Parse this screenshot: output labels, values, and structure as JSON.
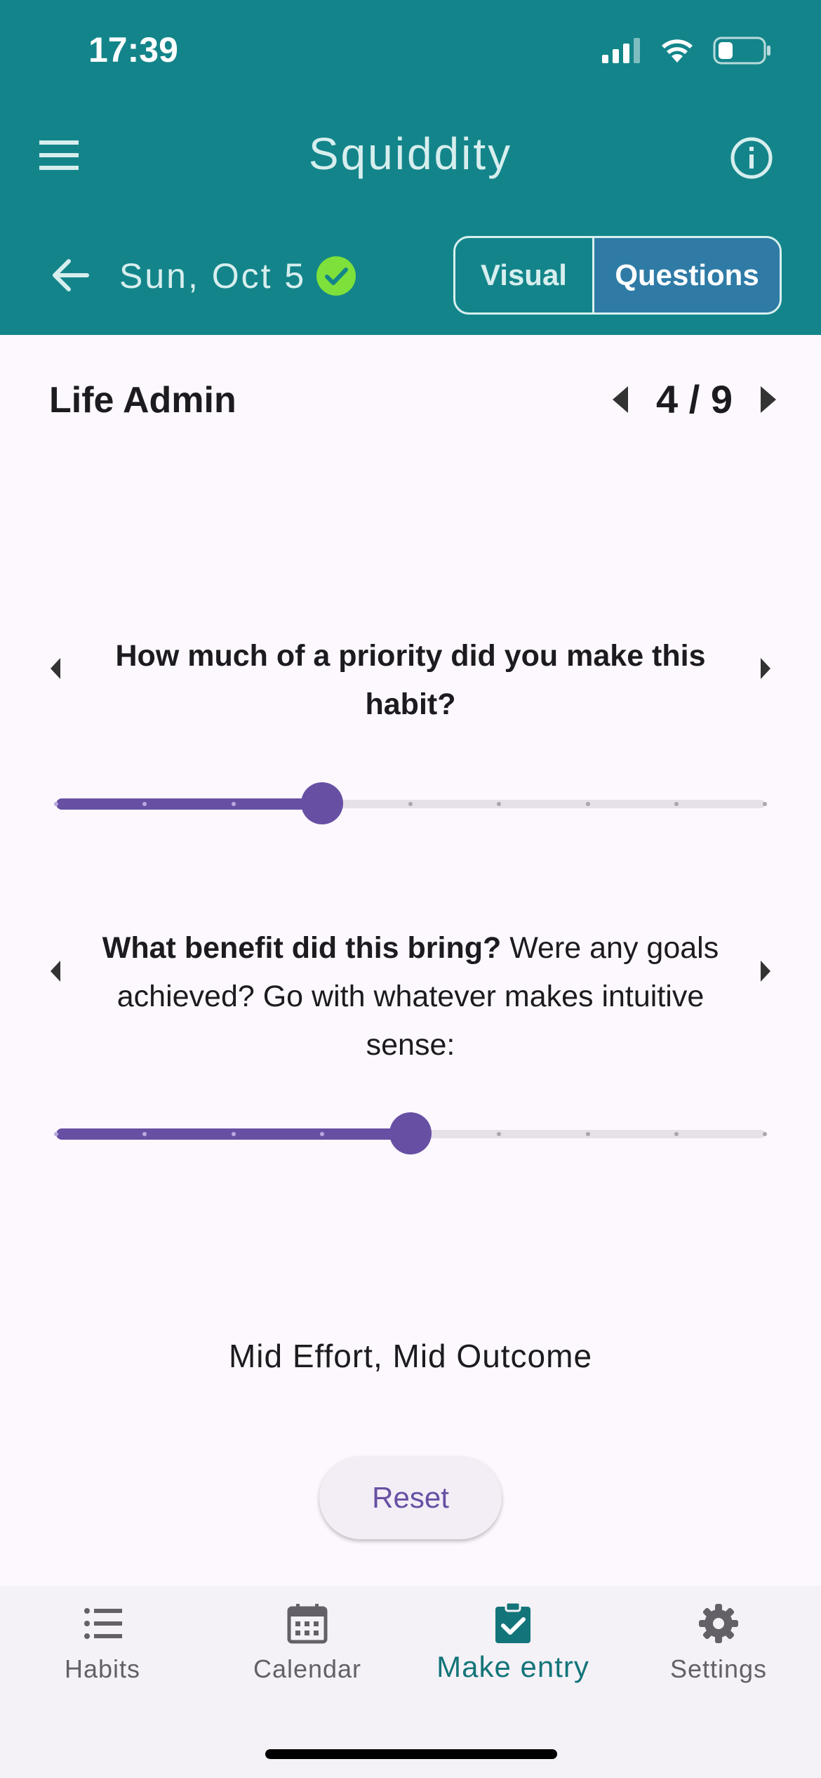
{
  "status_bar": {
    "time": "17:39"
  },
  "header": {
    "title": "Squiddity",
    "date": "Sun, Oct 5",
    "view_toggle": {
      "visual_label": "Visual",
      "questions_label": "Questions",
      "selected": "Questions"
    }
  },
  "section": {
    "title": "Life Admin",
    "page_indicator": "4 / 9"
  },
  "questions": [
    {
      "bold_text": "How much of a priority did you make this habit?",
      "normal_text": "",
      "slider": {
        "value": 3,
        "min": 0,
        "max": 8
      }
    },
    {
      "bold_text": "What benefit did this bring?",
      "normal_text": " Were any goals achieved? Go with whatever makes intuitive sense:",
      "slider": {
        "value": 4,
        "min": 0,
        "max": 8
      }
    }
  ],
  "result_text": "Mid Effort, Mid Outcome",
  "reset_label": "Reset",
  "bottom_nav": {
    "items": [
      {
        "label": "Habits",
        "icon": "list-icon"
      },
      {
        "label": "Calendar",
        "icon": "calendar-icon"
      },
      {
        "label": "Make entry",
        "icon": "clipboard-check-icon"
      },
      {
        "label": "Settings",
        "icon": "gear-icon"
      }
    ],
    "active": "Make entry"
  },
  "colors": {
    "header_bg": "#13858a",
    "accent": "#6750a4",
    "toggle_selected": "#2f7ba6",
    "nav_active": "#13757a",
    "check": "#7ee03a"
  }
}
